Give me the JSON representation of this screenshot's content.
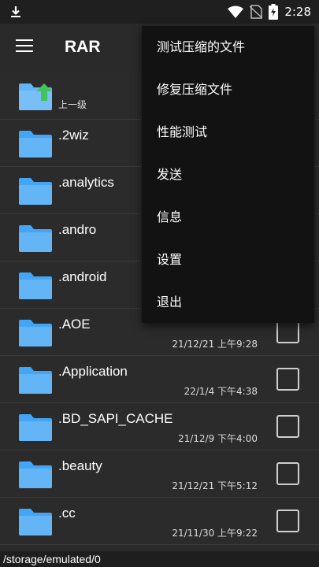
{
  "status_bar": {
    "time": "2:28",
    "left_icon": "download-icon",
    "right_icons": [
      "wifi-icon",
      "no-sim-icon",
      "battery-charging-icon"
    ]
  },
  "app_bar": {
    "title": "RAR",
    "menu_icon": "hamburger-menu-icon"
  },
  "colors": {
    "folder": "#64b5f6",
    "folder_tab": "#42a5f5",
    "up_arrow": "#43c35e",
    "background": "#2b2b2b",
    "popup": "#121212"
  },
  "file_list": {
    "parent": {
      "label": "上一级"
    },
    "items": [
      {
        "name": ".2wiz",
        "date": ""
      },
      {
        "name": ".analytics",
        "date": ""
      },
      {
        "name": ".andro",
        "date": ""
      },
      {
        "name": ".android",
        "date": ""
      },
      {
        "name": ".AOE",
        "date": "21/12/21 上午9:28"
      },
      {
        "name": ".Application",
        "date": "22/1/4 下午4:38"
      },
      {
        "name": ".BD_SAPI_CACHE",
        "date": "21/12/9 下午4:00"
      },
      {
        "name": ".beauty",
        "date": "21/12/21 下午5:12"
      },
      {
        "name": ".cc",
        "date": "21/11/30 上午9:22"
      }
    ]
  },
  "path_bar": {
    "path": "/storage/emulated/0"
  },
  "popup_menu": {
    "items": [
      {
        "label": "测试压缩的文件"
      },
      {
        "label": "修复压缩文件"
      },
      {
        "label": "性能测试"
      },
      {
        "label": "发送"
      },
      {
        "label": "信息"
      },
      {
        "label": "设置"
      },
      {
        "label": "退出"
      }
    ]
  }
}
